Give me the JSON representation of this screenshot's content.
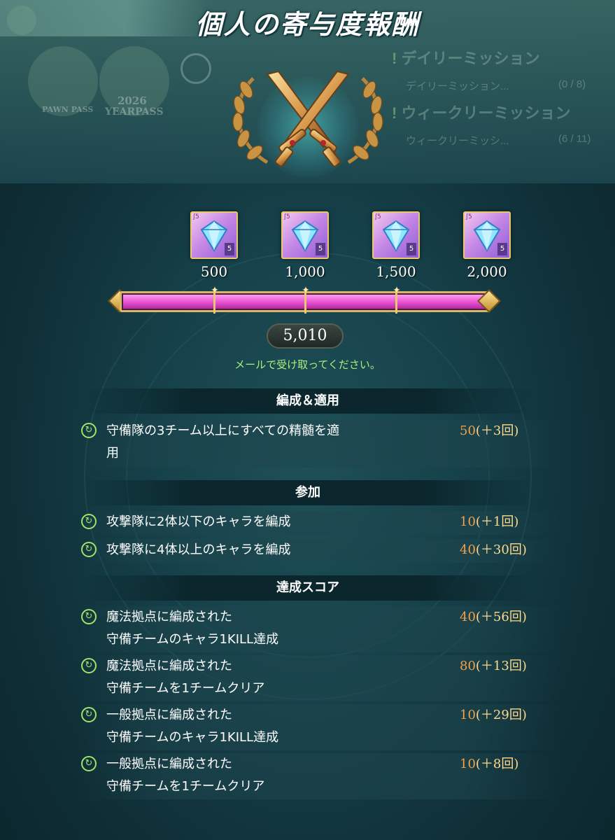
{
  "title": "個人の寄与度報酬",
  "background": {
    "pass_labels": [
      "2026",
      "YEARPASS",
      "PAWN PASS"
    ],
    "missions": [
      {
        "header": "デイリーミッション",
        "item": "デイリーミッション...",
        "progress": "(0 / 8)"
      },
      {
        "header": "ウィークリーミッション",
        "item": "ウィークリーミッシ...",
        "progress": "(6 / 11)"
      }
    ]
  },
  "rewards": [
    {
      "amount": "500",
      "rank": "5",
      "icon": "blue-crystal-icon"
    },
    {
      "amount": "1,000",
      "rank": "5",
      "icon": "blue-crystal-icon"
    },
    {
      "amount": "1,500",
      "rank": "5",
      "icon": "blue-crystal-icon"
    },
    {
      "amount": "2,000",
      "rank": "5",
      "icon": "blue-crystal-icon"
    }
  ],
  "progress": {
    "current_score": "5,010",
    "fill_fraction": 1.0
  },
  "mail_note": "メールで受け取ってください。",
  "sections": [
    {
      "heading": "編成＆適用",
      "items": [
        {
          "text": "守備隊の3チーム以上にすべての精髄を適\n用",
          "points": "50",
          "count": "(＋3回)"
        }
      ]
    },
    {
      "heading": "参加",
      "items": [
        {
          "text": "攻撃隊に2体以下のキャラを編成",
          "points": "10",
          "count": "(＋1回)"
        },
        {
          "text": "攻撃隊に4体以上のキャラを編成",
          "points": "40",
          "count": "(＋30回)"
        }
      ]
    },
    {
      "heading": "達成スコア",
      "items": [
        {
          "text": "魔法拠点に編成された\n守備チームのキャラ1KILL達成",
          "points": "40",
          "count": "(＋56回)"
        },
        {
          "text": "魔法拠点に編成された\n守備チームを1チームクリア",
          "points": "80",
          "count": "(＋13回)"
        },
        {
          "text": "一般拠点に編成された\n守備チームのキャラ1KILL達成",
          "points": "10",
          "count": "(＋29回)"
        },
        {
          "text": "一般拠点に編成された\n守備チームを1チームクリア",
          "points": "10",
          "count": "(＋8回)"
        }
      ]
    }
  ],
  "colors": {
    "accent_points": "#f0a24a",
    "note_green": "#a8f07a",
    "bar_fill": "#e64fd1",
    "gold": "#d8b866"
  }
}
